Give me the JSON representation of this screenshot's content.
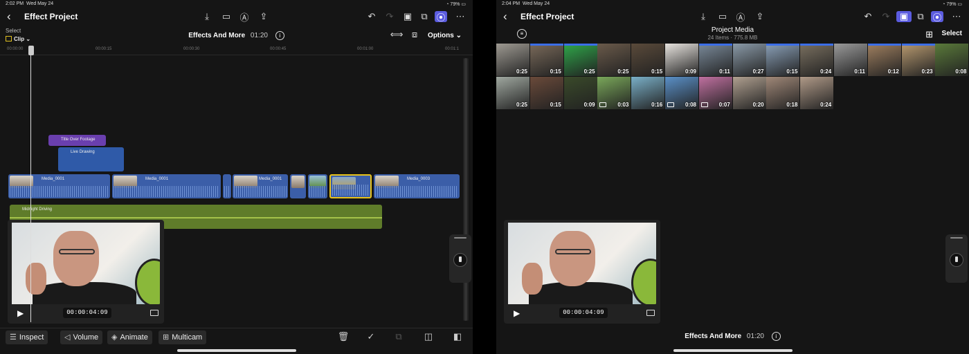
{
  "left": {
    "status": {
      "time": "2:02 PM",
      "date": "Wed May 24",
      "battery": "79%"
    },
    "title": "Effect Project",
    "project_name": "Effects And More",
    "duration": "01:20",
    "select_label": "Select",
    "clip_label": "Clip",
    "options_label": "Options",
    "ruler_ticks": [
      "00:00:00",
      "00:00:15",
      "00:00:30",
      "00:00:45",
      "00:01:00",
      "00:01:1"
    ],
    "title_clip": "Title Over Footage",
    "drawing_clip": "Live Drawing",
    "video_clips": [
      "Media_0001",
      "Media_0001",
      "Media_0001",
      "Media_0003"
    ],
    "audio_clip": "Midnight Driving",
    "timecode": "00:00:04:09",
    "toolbar": {
      "inspect": "Inspect",
      "volume": "Volume",
      "animate": "Animate",
      "multicam": "Multicam"
    }
  },
  "right": {
    "status": {
      "time": "2:04 PM",
      "date": "Wed May 24",
      "battery": "79%"
    },
    "title": "Effect Project",
    "browser_title": "Project Media",
    "browser_sub": "24 Items · 775.8 MB",
    "select_label": "Select",
    "timecode": "00:00:04:09",
    "project_name": "Effects And More",
    "duration": "01:20",
    "media": [
      {
        "dur": "0:25",
        "color": "#9e9a92",
        "used": 0
      },
      {
        "dur": "0:15",
        "color": "#7a6a5a",
        "used": 1
      },
      {
        "dur": "0:25",
        "color": "#2fa84a",
        "used": 1
      },
      {
        "dur": "0:25",
        "color": "#6a5a4a",
        "used": 0
      },
      {
        "dur": "0:15",
        "color": "#5a4a3a",
        "used": 0
      },
      {
        "dur": "0:09",
        "color": "#e8e4df",
        "used": 0
      },
      {
        "dur": "0:11",
        "color": "#7a8a9a",
        "used": 1
      },
      {
        "dur": "0:27",
        "color": "#8a9aa8",
        "used": 0
      },
      {
        "dur": "0:15",
        "color": "#8aa0b8",
        "used": 1
      },
      {
        "dur": "0:24",
        "color": "#7a7060",
        "used": 1
      },
      {
        "dur": "0:11",
        "color": "#9a9a9a",
        "used": 0
      },
      {
        "dur": "0:12",
        "color": "#a08060",
        "used": 1
      },
      {
        "dur": "0:23",
        "color": "#b89a70",
        "used": 1
      },
      {
        "dur": "0:08",
        "color": "#5a7a3a",
        "used": 0
      },
      {
        "dur": "0:25",
        "color": "#a0a8a0",
        "used": 0
      },
      {
        "dur": "0:15",
        "color": "#6a4a3a",
        "used": 0
      },
      {
        "dur": "0:09",
        "color": "#3a4a2a",
        "used": 0
      },
      {
        "dur": "0:03",
        "color": "#7aa85a",
        "used": 0,
        "cam": 1
      },
      {
        "dur": "0:16",
        "color": "#7ab0c8",
        "used": 0
      },
      {
        "dur": "0:08",
        "color": "#5a90c8",
        "used": 0,
        "cam": 1
      },
      {
        "dur": "0:07",
        "color": "#c070a0",
        "used": 0,
        "cam": 1
      },
      {
        "dur": "0:20",
        "color": "#b0a090",
        "used": 0
      },
      {
        "dur": "0:18",
        "color": "#a08878",
        "used": 0
      },
      {
        "dur": "0:24",
        "color": "#b09a88",
        "used": 0
      }
    ]
  }
}
